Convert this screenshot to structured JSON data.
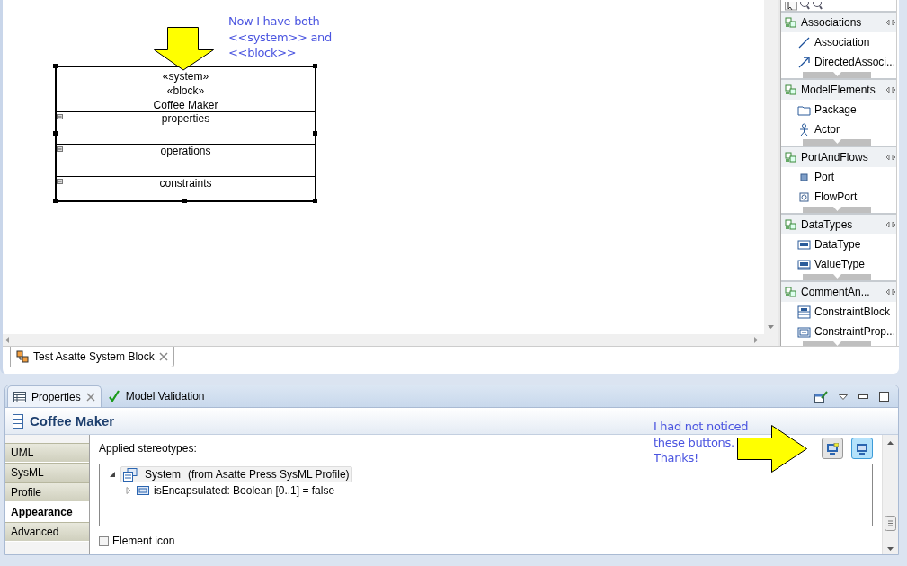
{
  "diagram": {
    "block": {
      "stereotypes": [
        "«system»",
        "«block»"
      ],
      "name": "Coffee Maker",
      "compartments": [
        "properties",
        "operations",
        "constraints"
      ]
    }
  },
  "editor_tab": {
    "label": "Test Asatte System Block"
  },
  "palette": {
    "drawers": [
      {
        "title": "Associations",
        "items": [
          {
            "label": "Association"
          },
          {
            "label": "DirectedAssoci..."
          }
        ]
      },
      {
        "title": "ModelElements",
        "items": [
          {
            "label": "Package"
          },
          {
            "label": "Actor"
          }
        ]
      },
      {
        "title": "PortAndFlows",
        "items": [
          {
            "label": "Port"
          },
          {
            "label": "FlowPort"
          }
        ]
      },
      {
        "title": "DataTypes",
        "items": [
          {
            "label": "DataType"
          },
          {
            "label": "ValueType"
          }
        ]
      },
      {
        "title": "CommentAn...",
        "items": [
          {
            "label": "ConstraintBlock"
          },
          {
            "label": "ConstraintProp..."
          }
        ]
      }
    ]
  },
  "properties": {
    "tabs": [
      {
        "label": "Properties",
        "selected": true
      },
      {
        "label": "Model Validation",
        "selected": false
      }
    ],
    "title": "Coffee Maker",
    "categories": [
      {
        "label": "UML",
        "selected": false
      },
      {
        "label": "SysML",
        "selected": false
      },
      {
        "label": "Profile",
        "selected": false
      },
      {
        "label": "Appearance",
        "selected": true
      },
      {
        "label": "Advanced",
        "selected": false
      }
    ],
    "applied_stereotypes_label": "Applied stereotypes:",
    "toggle_buttons": [
      {
        "selected": false
      },
      {
        "selected": true
      }
    ],
    "tree": [
      {
        "label": "System",
        "source": "(from Asatte Press SysML Profile)",
        "expanded": true,
        "children": [
          {
            "label": "isEncapsulated: Boolean [0..1] = false",
            "expanded": false
          }
        ]
      }
    ],
    "element_icon": {
      "label": "Element icon",
      "checked": false
    }
  },
  "annotations": [
    {
      "text": "Now I have both\n<<system>> and\n<<block>>",
      "kind": "down-arrow"
    },
    {
      "text": "I had not noticed\nthese buttons.\nThanks!",
      "kind": "right-arrow"
    }
  ]
}
